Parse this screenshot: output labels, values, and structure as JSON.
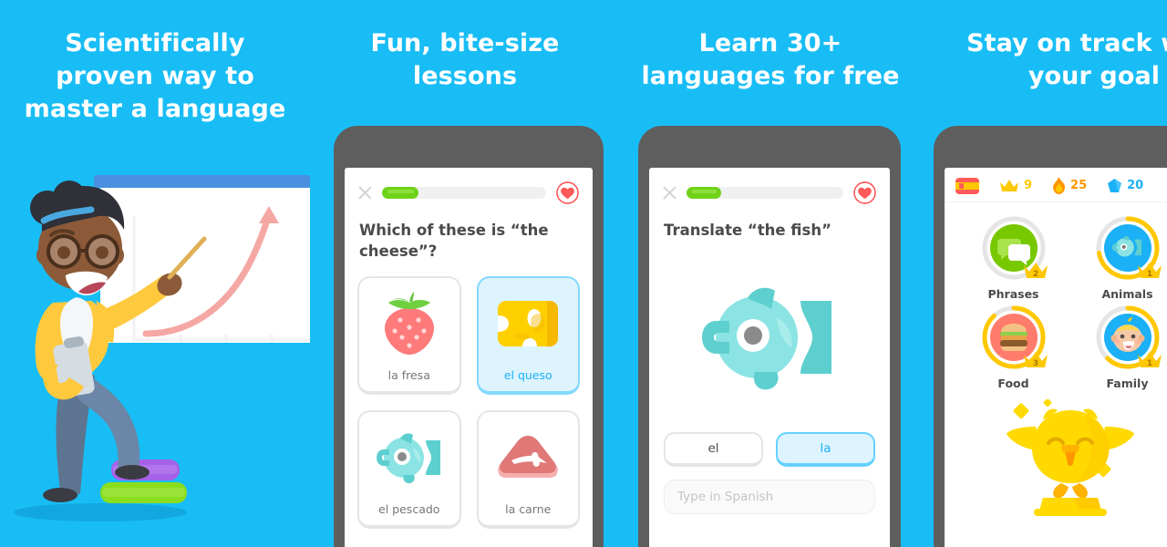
{
  "background_color": "#19bdf5",
  "panels": [
    {
      "id": "panel-science",
      "headline": "Scientifically\nproven way to\nmaster a language",
      "illustration": "teacher-pointing-at-growth-chart"
    },
    {
      "id": "panel-lessons",
      "headline": "Fun, bite-size\nlessons",
      "lesson": {
        "close_icon": "close-icon",
        "progress_percent": 22,
        "hearts_icon": "heart-icon",
        "question": "Which of these is “the cheese”?",
        "answers": [
          {
            "label": "la fresa",
            "icon": "strawberry-icon",
            "selected": false
          },
          {
            "label": "el queso",
            "icon": "cheese-icon",
            "selected": true
          },
          {
            "label": "el pescado",
            "icon": "fish-icon",
            "selected": false
          },
          {
            "label": "la carne",
            "icon": "meat-icon",
            "selected": false
          }
        ]
      }
    },
    {
      "id": "panel-languages",
      "headline": "Learn 30+\nlanguages for free",
      "lesson": {
        "close_icon": "close-icon",
        "progress_percent": 22,
        "hearts_icon": "heart-icon",
        "question": "Translate “the fish”",
        "prompt_icon": "fish-icon",
        "word_bank": [
          {
            "label": "el",
            "selected": false
          },
          {
            "label": "la",
            "selected": true
          }
        ],
        "input_placeholder": "Type in Spanish"
      }
    },
    {
      "id": "panel-goal",
      "headline": "Stay on track with\nyour goal",
      "home": {
        "status": [
          {
            "name": "language-flag",
            "icon": "spain-flag-icon",
            "value": ""
          },
          {
            "name": "crown-count",
            "icon": "crown-icon",
            "value": "9"
          },
          {
            "name": "streak-count",
            "icon": "flame-icon",
            "value": "25"
          },
          {
            "name": "gem-count",
            "icon": "gem-icon",
            "value": "20"
          }
        ],
        "skills": [
          {
            "name": "Phrases",
            "icon": "speech-bubbles-icon",
            "color": "#78c800",
            "crown": "2",
            "progress": 100,
            "ring_color": "#e5e5e5"
          },
          {
            "name": "Animals",
            "icon": "fish-icon",
            "color": "#1cb0f6",
            "crown": "1",
            "progress": 72,
            "ring_color": "#ffc800"
          },
          {
            "name": "Food",
            "icon": "burger-icon",
            "color": "#ff7b6b",
            "crown": "3",
            "progress": 88,
            "ring_color": "#ffc800"
          },
          {
            "name": "Family",
            "icon": "baby-face-icon",
            "color": "#1cb0f6",
            "crown": "1",
            "progress": 62,
            "ring_color": "#ffc800"
          }
        ],
        "mascot": "duo-owl-trophy-icon"
      }
    }
  ]
}
